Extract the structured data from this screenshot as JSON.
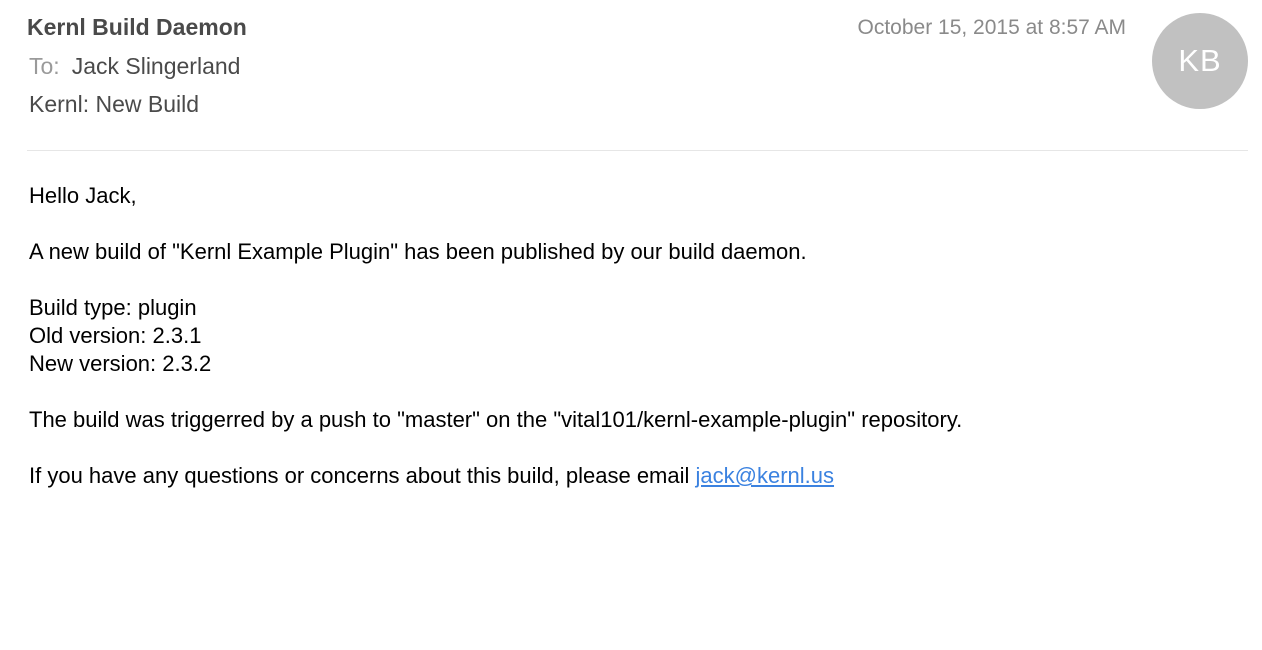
{
  "header": {
    "sender": "Kernl Build Daemon",
    "date": "October 15, 2015 at 8:57 AM",
    "avatar_initials": "KB",
    "to_label": "To:",
    "to_name": "Jack Slingerland",
    "subject": "Kernl: New Build"
  },
  "body": {
    "greeting": "Hello Jack,",
    "intro": "A new build of \"Kernl Example Plugin\" has been published by our build daemon.",
    "build_type": "Build type:  plugin",
    "old_version": "Old version:  2.3.1",
    "new_version": "New version:  2.3.2",
    "trigger": "The build was triggerred by a push to \"master\" on the \"vital101/kernl-example-plugin\" repository.",
    "contact_text": "If you have any questions or concerns about this build, please email ",
    "contact_email": "jack@kernl.us"
  },
  "colors": {
    "link": "#3b82e0",
    "avatar_bg": "#c1c1c1",
    "header_text": "#4a4a4a",
    "muted_text": "#8a8a8a"
  }
}
